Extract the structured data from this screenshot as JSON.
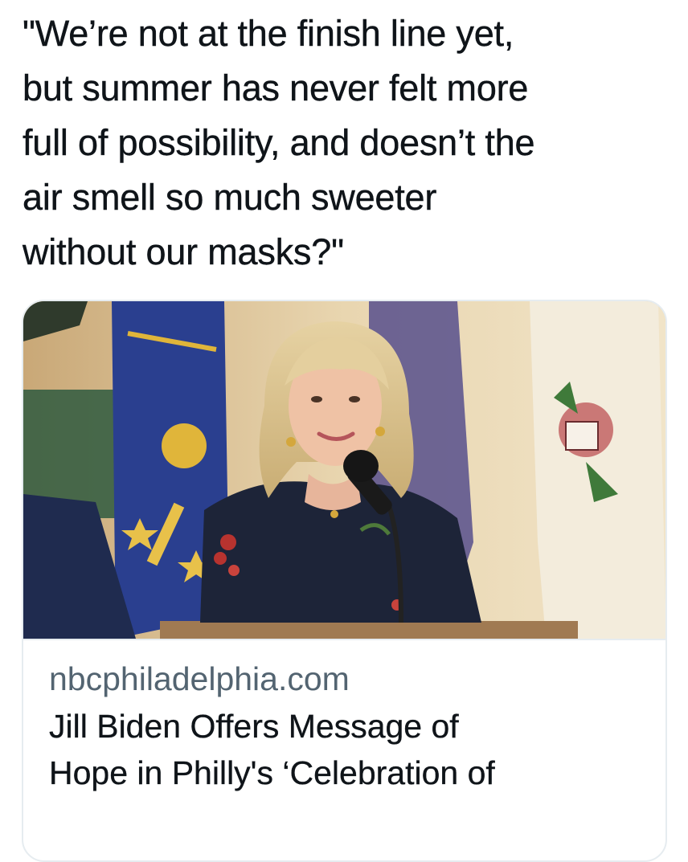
{
  "tweet": {
    "text_lines": [
      "\"We’re not at the finish line yet,",
      "but summer has never felt more",
      "full of possibility, and doesn’t the",
      "air smell so much sweeter",
      "without our masks?\""
    ]
  },
  "link_card": {
    "image_description_icon": "photo",
    "domain": "nbcphiladelphia.com",
    "title_lines": [
      "Jill Biden Offers Message of",
      "Hope in Philly's ‘Celebration of"
    ]
  },
  "colors": {
    "text_primary": "#0f1419",
    "text_secondary": "#536471",
    "card_border": "#e6ecf0"
  }
}
